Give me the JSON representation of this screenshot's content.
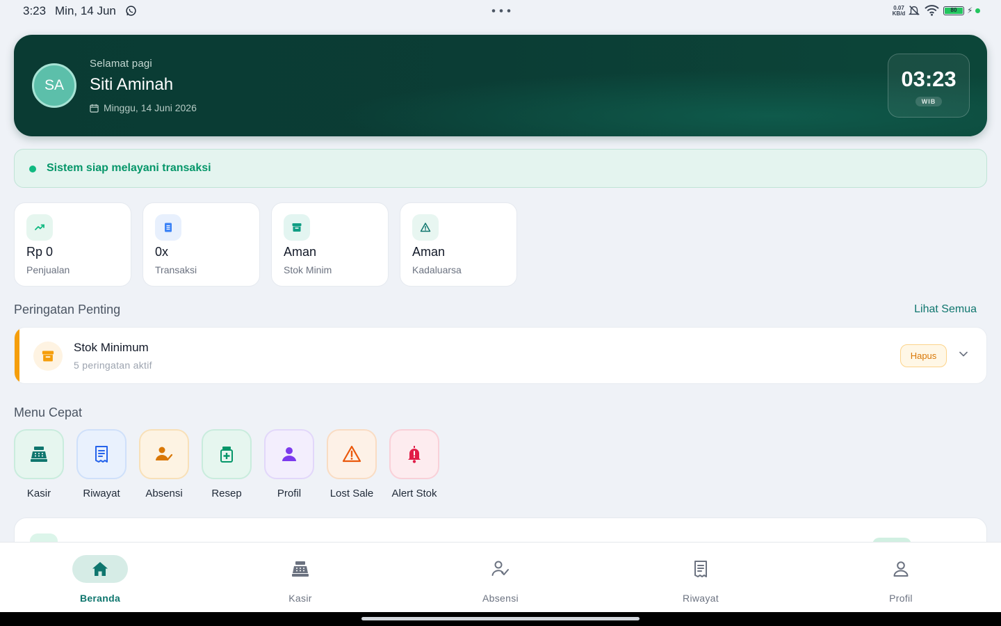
{
  "status_bar": {
    "time": "3:23",
    "date": "Min, 14 Jun",
    "net_speed_value": "0.07",
    "net_speed_unit": "KB/d",
    "battery": "80"
  },
  "hero": {
    "avatar_initials": "SA",
    "greeting": "Selamat pagi",
    "user_name": "Siti Aminah",
    "date": "Minggu, 14 Juni 2026",
    "clock_time": "03:23",
    "clock_tz": "WIB"
  },
  "system_status": {
    "text": "Sistem siap melayani transaksi",
    "color": "#10b981"
  },
  "stats": [
    {
      "value": "Rp 0",
      "label": "Penjualan",
      "icon": "trending-up-icon"
    },
    {
      "value": "0x",
      "label": "Transaksi",
      "icon": "receipt-icon"
    },
    {
      "value": "Aman",
      "label": "Stok Minim",
      "icon": "archive-box-icon"
    },
    {
      "value": "Aman",
      "label": "Kadaluarsa",
      "icon": "warning-triangle-icon"
    }
  ],
  "alerts_section": {
    "title": "Peringatan Penting",
    "see_all": "Lihat Semua",
    "items": [
      {
        "title": "Stok Minimum",
        "subtitle": "5 peringatan aktif",
        "action": "Hapus",
        "accent": "#f59e0b",
        "icon": "archive-box-icon"
      }
    ]
  },
  "quick_menu": {
    "title": "Menu Cepat",
    "items": [
      {
        "label": "Kasir",
        "icon": "cash-register-icon",
        "color": "#0f766e"
      },
      {
        "label": "Riwayat",
        "icon": "receipt-list-icon",
        "color": "#2563eb"
      },
      {
        "label": "Absensi",
        "icon": "user-check-icon",
        "color": "#d97706"
      },
      {
        "label": "Resep",
        "icon": "medicine-icon",
        "color": "#059669"
      },
      {
        "label": "Profil",
        "icon": "user-icon",
        "color": "#7c3aed"
      },
      {
        "label": "Lost Sale",
        "icon": "warning-triangle-icon",
        "color": "#ea580c"
      },
      {
        "label": "Alert Stok",
        "icon": "bell-alert-icon",
        "color": "#e11d48"
      }
    ]
  },
  "bottom_nav": {
    "items": [
      {
        "label": "Beranda",
        "icon": "home-icon",
        "active": true
      },
      {
        "label": "Kasir",
        "icon": "cash-register-icon",
        "active": false
      },
      {
        "label": "Absensi",
        "icon": "user-check-icon",
        "active": false
      },
      {
        "label": "Riwayat",
        "icon": "receipt-list-icon",
        "active": false
      },
      {
        "label": "Profil",
        "icon": "user-icon",
        "active": false
      }
    ]
  }
}
